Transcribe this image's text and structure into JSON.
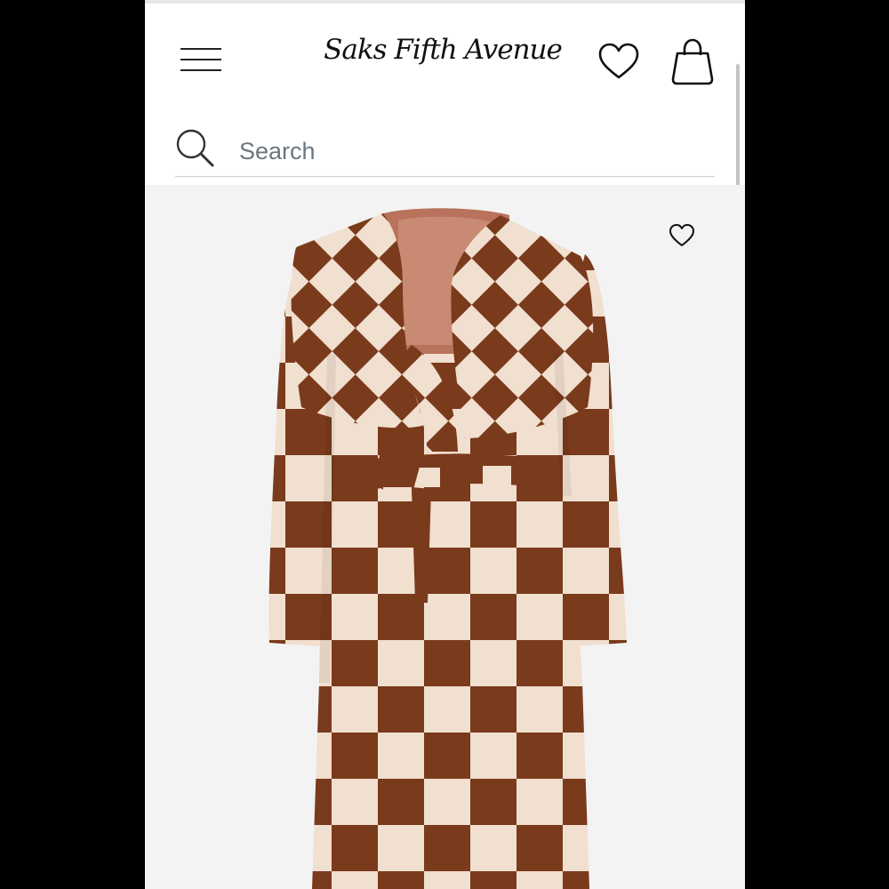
{
  "header": {
    "brand": "Saks Fifth Avenue",
    "menu_icon": "hamburger-menu-icon",
    "wishlist_icon": "heart-icon",
    "bag_icon": "shopping-bag-icon"
  },
  "search": {
    "placeholder": "Search",
    "icon": "search-icon"
  },
  "product": {
    "image": "checkered-wrap-coat",
    "wishlist_icon": "heart-icon",
    "colors": {
      "brown": "#7a3a1c",
      "cream": "#f1dfcf",
      "background": "#f3f3f3"
    }
  }
}
